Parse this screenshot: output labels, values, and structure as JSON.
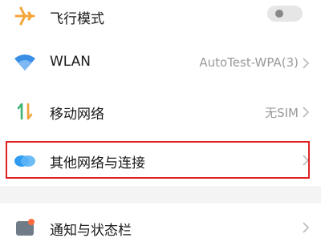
{
  "settings": {
    "items": [
      {
        "label": "飞行模式",
        "icon": "airplane-icon",
        "toggle": "off"
      },
      {
        "label": "WLAN",
        "value": "AutoTest-WPA(3)",
        "icon": "wifi-icon"
      },
      {
        "label": "移动网络",
        "value": "无SIM",
        "icon": "mobile-network-icon"
      },
      {
        "label": "其他网络与连接",
        "icon": "connections-icon",
        "highlighted": true
      },
      {
        "label": "通知与状态栏",
        "icon": "notification-icon"
      }
    ]
  },
  "colors": {
    "highlight_border": "#e02222",
    "airplane_icon": "#f4a53a",
    "wifi_icon": "#3a8ee6",
    "mobile_icon_green": "#3cb371",
    "mobile_icon_orange": "#f0a23a",
    "connections_icon": "#2f9cf0"
  }
}
